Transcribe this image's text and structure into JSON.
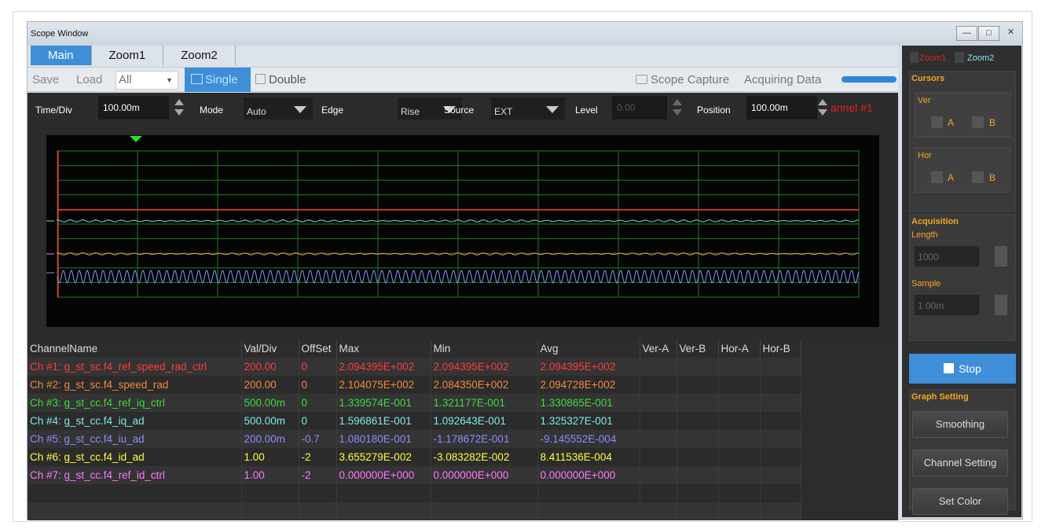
{
  "window": {
    "title": "Scope Window"
  },
  "tabs": [
    {
      "label": "Main",
      "active": true
    },
    {
      "label": "Zoom1",
      "active": false
    },
    {
      "label": "Zoom2",
      "active": false
    }
  ],
  "toolbar": {
    "save_label": "Save",
    "load_label": "Load",
    "load_select_value": "All",
    "single_label": "Single",
    "double_label": "Double",
    "capture_label": "Scope Capture",
    "status_label": "Acquiring Data"
  },
  "controls": {
    "timediv_label": "Time/Div",
    "timediv_value": "100.00m",
    "mode_label": "Mode",
    "mode_value": "Auto",
    "edge_label": "Edge",
    "edge_value": "Rise",
    "source_label": "Source",
    "source_value": "EXT",
    "level_label": "Level",
    "level_value": "0.00",
    "position_label": "Position",
    "position_value": "100.00m",
    "channel_overlay": "annel #1"
  },
  "table": {
    "headers": [
      "ChannelName",
      "Val/Div",
      "OffSet",
      "Max",
      "Min",
      "Avg",
      "Ver-A",
      "Ver-B",
      "Hor-A",
      "Hor-B"
    ],
    "rows": [
      {
        "color": "#ff3c3c",
        "cells": [
          "Ch #1: g_st_sc.f4_ref_speed_rad_ctrl",
          "200.00",
          "0",
          "2.094395E+002",
          "2.094395E+002",
          "2.094395E+002",
          "",
          "",
          "",
          ""
        ]
      },
      {
        "color": "#f28a3c",
        "cells": [
          "Ch #2: g_st_sc.f4_speed_rad",
          "200.00",
          "0",
          "2.104075E+002",
          "2.084350E+002",
          "2.094728E+002",
          "",
          "",
          "",
          ""
        ]
      },
      {
        "color": "#3cdc3c",
        "cells": [
          "Ch #3: g_st_cc.f4_ref_iq_ctrl",
          "500.00m",
          "0",
          "1.339574E-001",
          "1.321177E-001",
          "1.330865E-001",
          "",
          "",
          "",
          ""
        ]
      },
      {
        "color": "#7ee8ea",
        "cells": [
          "Ch #4: g_st_cc.f4_iq_ad",
          "500.00m",
          "0",
          "1.596861E-001",
          "1.092643E-001",
          "1.325327E-001",
          "",
          "",
          "",
          ""
        ]
      },
      {
        "color": "#8c8cff",
        "cells": [
          "Ch #5: g_st_cc.f4_iu_ad",
          "200.00m",
          "-0.7",
          "1.080180E-001",
          "-1.178672E-001",
          "-9.145552E-004",
          "",
          "",
          "",
          ""
        ]
      },
      {
        "color": "#ffff3c",
        "cells": [
          "Ch #6: g_st_cc.f4_id_ad",
          "1.00",
          "-2",
          "3.655279E-002",
          "-3.083282E-002",
          "8.411536E-004",
          "",
          "",
          "",
          ""
        ]
      },
      {
        "color": "#ff78ff",
        "cells": [
          "Ch #7: g_st_cc.f4_ref_id_ctrl",
          "1.00",
          "-2",
          "0.000000E+000",
          "0.000000E+000",
          "0.000000E+000",
          "",
          "",
          "",
          ""
        ]
      }
    ]
  },
  "side": {
    "zoom1_label": "Zoom1",
    "zoom2_label": "Zoom2",
    "cursors_title": "Cursors",
    "ver_label": "Ver",
    "hor_label": "Hor",
    "a_label": "A",
    "b_label": "B",
    "acq_title": "Acquisition",
    "length_label": "Length",
    "length_value": "1000",
    "sample_label": "Sample",
    "sample_value": "1.00m",
    "stop_label": "Stop",
    "graph_title": "Graph Setting",
    "smoothing_label": "Smoothing",
    "channel_setting_label": "Channel Setting",
    "set_color_label": "Set Color"
  },
  "colors": {
    "accent": "#3f8ed8",
    "cursor_label": "#f5a623",
    "trace_red": "#ff2a2a",
    "trace_cyan": "#5ee6d4",
    "trace_orange": "#f0a050",
    "trace_blue": "#7a9cff",
    "grid": "#1e7a1e"
  }
}
